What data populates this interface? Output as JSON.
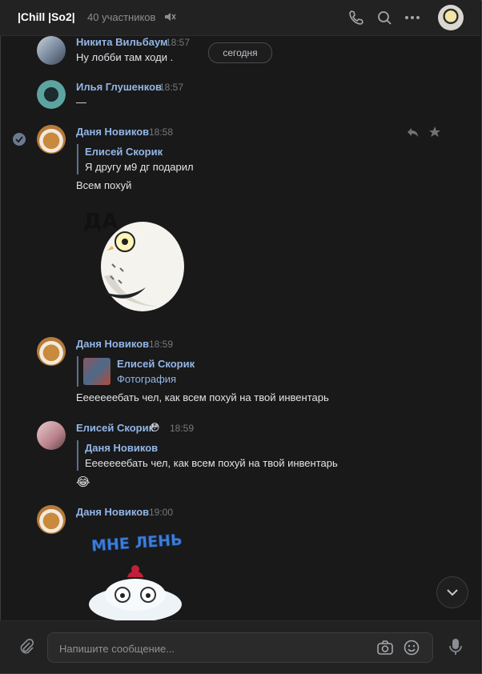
{
  "header": {
    "title": "|Chill |So2|",
    "members": "40 участников",
    "icons": [
      "mute-icon",
      "phone-icon",
      "search-icon",
      "more-icon"
    ]
  },
  "date_divider": "сегодня",
  "messages": [
    {
      "author": "Никита Вильбаум",
      "time": "18:57",
      "text": "Ну лобби там ходи ."
    },
    {
      "author": "Илья Глушенков",
      "time": "18:57",
      "text": "—"
    },
    {
      "author": "Даня Новиков",
      "time": "18:58",
      "quote": {
        "author": "Елисей Скорик",
        "text": "Я другу м9 дг подарил"
      },
      "text": "Всем похуй",
      "sticker_text": "ДА"
    },
    {
      "author": "Даня Новиков",
      "time": "18:59",
      "quote": {
        "author": "Елисей Скорик",
        "text": "Фотография"
      },
      "text": "Еееееееб​ать чел, как всем похуй на твой инвентарь"
    },
    {
      "author": "Елисей Скорик",
      "author_emoji": "😳",
      "time": "18:59",
      "quote": {
        "author": "Даня Новиков",
        "text": "Еееееееб​ать чел, как всем похуй на твой инвентарь"
      },
      "text": "😂"
    },
    {
      "author": "Даня Новиков",
      "time": "19:00",
      "sticker_text": "МНЕ ЛЕНЬ"
    }
  ],
  "composer": {
    "placeholder": "Напишите сообщение..."
  },
  "colors": {
    "background": "#19191a",
    "header": "#222222",
    "author": "#93b6e6",
    "text": "#e1e3e6"
  }
}
